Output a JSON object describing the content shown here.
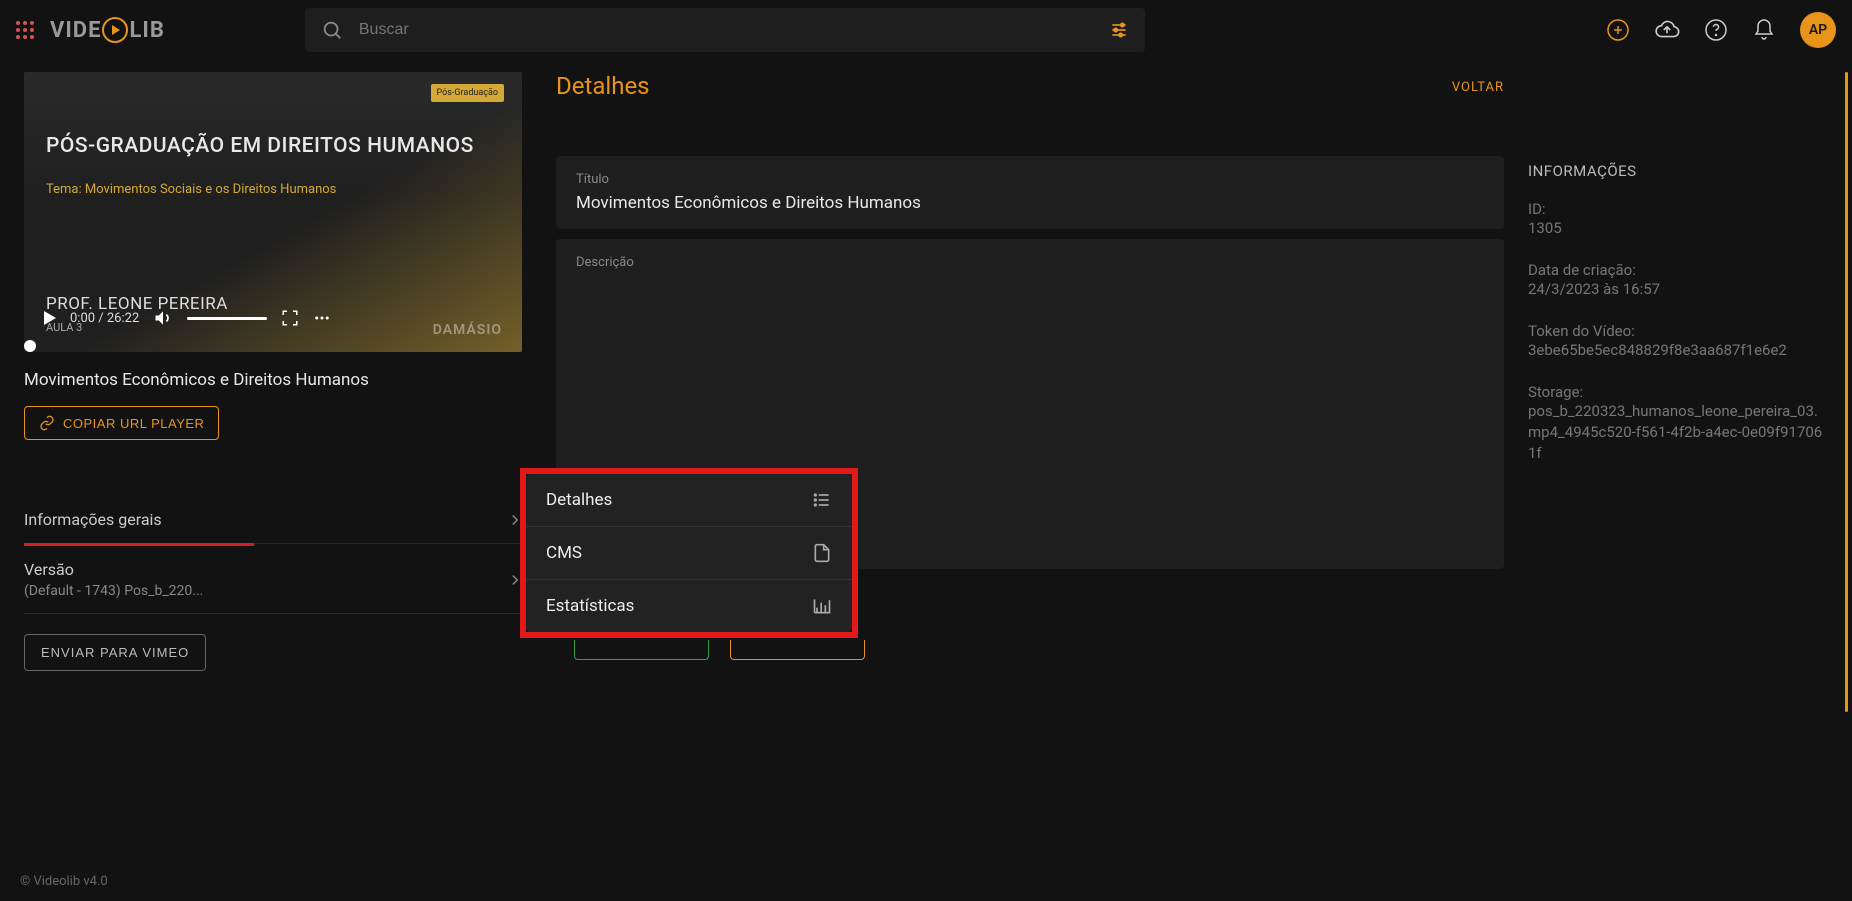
{
  "header": {
    "logo_part1": "VIDE",
    "logo_part2": "LIB",
    "search_placeholder": "Buscar",
    "avatar_initials": "AP"
  },
  "video": {
    "thumbnail_badge": "Pós-Graduação",
    "thumbnail_heading": "PÓS-GRADUAÇÃO EM DIREITOS HUMANOS",
    "thumbnail_theme": "Tema: Movimentos Sociais e os Direitos Humanos",
    "thumbnail_prof": "PROF. LEONE PEREIRA",
    "thumbnail_aula": "AULA 3",
    "thumbnail_brand": "DAMÁSIO",
    "player_time": "0:00 / 26:22",
    "title_below": "Movimentos Econômicos e Direitos Humanos",
    "copy_btn": "COPIAR URL PLAYER"
  },
  "accordion": {
    "item1": "Informações gerais",
    "item2_title": "Versão",
    "item2_sub": "(Default - 1743) Pos_b_220..."
  },
  "vimeo_btn": "ENVIAR PARA VIMEO",
  "details": {
    "section_title": "Detalhes",
    "voltar": "VOLTAR",
    "field_titulo_label": "Título",
    "field_titulo_value": "Movimentos Econômicos e Direitos Humanos",
    "field_desc_label": "Descrição"
  },
  "info": {
    "heading": "INFORMAÇÕES",
    "id_label": "ID:",
    "id_value": "1305",
    "created_label": "Data de criação:",
    "created_value": "24/3/2023 às 16:57",
    "token_label": "Token do Vídeo:",
    "token_value": "3ebe65be5ec848829f8e3aa687f1e6e2",
    "storage_label": "Storage:",
    "storage_value": "pos_b_220323_humanos_leone_pereira_03.mp4_4945c520-f561-4f2b-a4ec-0e09f917061f"
  },
  "popup": {
    "item1": "Detalhes",
    "item2": "CMS",
    "item3": "Estatísticas"
  },
  "footer": "© Videolib v4.0"
}
